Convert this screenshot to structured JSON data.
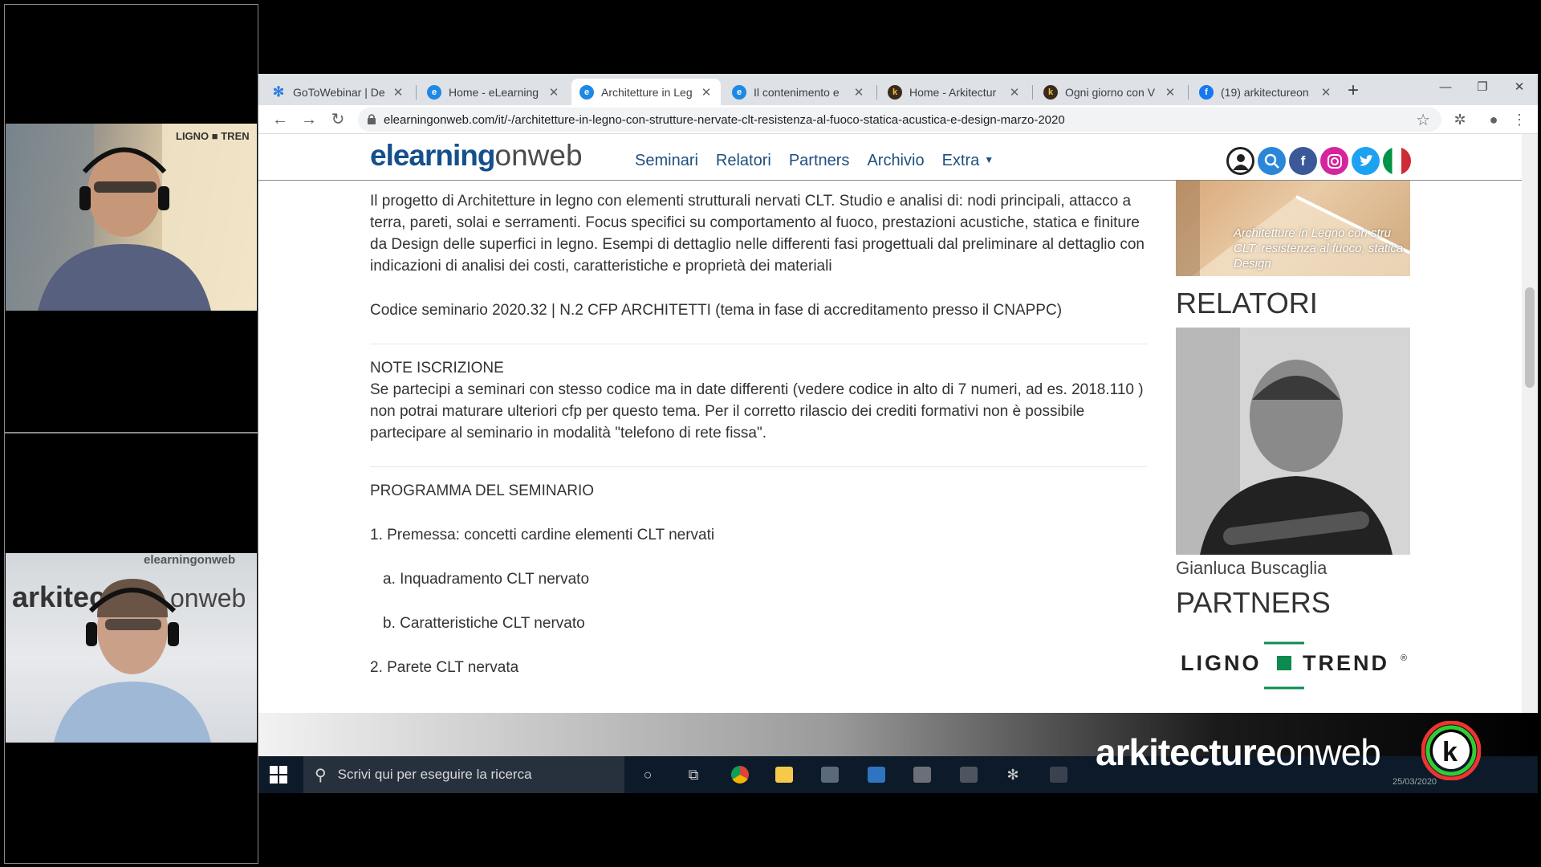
{
  "webinar": {
    "cam_top_name": "presenter-webcam",
    "cam_bottom_name": "host-webcam",
    "cam_top_banner": "LIGNO ■ TREN",
    "cam_bottom_banner_a": "elearningonweb",
    "cam_bottom_banner_b": "arkitec",
    "cam_bottom_banner_c": "onweb"
  },
  "browser": {
    "tabs": [
      {
        "title": "GoToWebinar | De",
        "icon": "snowflake-icon",
        "color": "#2d7de0"
      },
      {
        "title": "Home - eLearning",
        "icon": "e-icon",
        "color": "#1e88e5"
      },
      {
        "title": "Architetture in Leg",
        "icon": "e-icon",
        "color": "#1e88e5"
      },
      {
        "title": "Il contenimento e",
        "icon": "e-icon",
        "color": "#1e88e5"
      },
      {
        "title": "Home - Arkitectur",
        "icon": "k-icon",
        "color": "#3a2a1a"
      },
      {
        "title": "Ogni giorno con V",
        "icon": "k-icon",
        "color": "#3a2a1a"
      },
      {
        "title": "(19) arkitectureon",
        "icon": "facebook-icon",
        "color": "#1877f2"
      }
    ],
    "tab_close": "✕",
    "new_tab": "+",
    "url": "elearningonweb.com/it/-/architetture-in-legno-con-strutture-nervate-clt-resistenza-al-fuoco-statica-acustica-e-design-marzo-2020"
  },
  "site": {
    "logo_a": "elearning",
    "logo_b": "onweb",
    "nav": [
      "Seminari",
      "Relatori",
      "Partners",
      "Archivio",
      "Extra"
    ],
    "social": [
      {
        "name": "user-icon",
        "glyph": "◯",
        "color": "#222222"
      },
      {
        "name": "search-icon",
        "glyph": "⌕",
        "color": "#2a86d8"
      },
      {
        "name": "facebook-icon",
        "glyph": "f",
        "color": "#3b5998"
      },
      {
        "name": "instagram-icon",
        "glyph": "◎",
        "color": "#d6249f"
      },
      {
        "name": "twitter-icon",
        "glyph": "t",
        "color": "#1da1f2"
      },
      {
        "name": "italy-flag-icon",
        "glyph": "",
        "color": "#ffffff"
      }
    ]
  },
  "content": {
    "intro": "Il progetto di Architetture in legno con elementi strutturali nervati CLT. Studio e analisi di: nodi principali, attacco a terra, pareti, solai e serramenti. Focus specifici su comportamento al fuoco, prestazioni acustiche, statica e finiture da Design delle superfici in legno. Esempi di dettaglio nelle differenti fasi progettuali dal preliminare al dettaglio con indicazioni di analisi dei costi, caratteristiche e proprietà dei materiali",
    "codice": "Codice seminario 2020.32 | N.2 CFP ARCHITETTI (tema in fase di accreditamento presso il CNAPPC)",
    "note_title": "NOTE ISCRIZIONE",
    "note_body": "Se partecipi a seminari con stesso codice ma in date differenti (vedere codice in alto di 7 numeri, ad es. 2018.110 ) non potrai maturare ulteriori cfp per questo tema. Per il corretto rilascio dei crediti formativi non è possibile partecipare al seminario in modalità \"telefono di rete fissa\".",
    "program_title": "PROGRAMMA DEL SEMINARIO",
    "program": [
      {
        "text": "1. Premessa: concetti cardine elementi CLT nervati",
        "sub": false
      },
      {
        "text": "a. Inquadramento CLT nervato",
        "sub": true
      },
      {
        "text": "b. Caratteristiche CLT nervato",
        "sub": true
      },
      {
        "text": "2. Parete CLT nervata",
        "sub": false
      }
    ]
  },
  "sidebar": {
    "banner_caption": "Architetture in Legno con stru CLT: resistenza al fuoco, statica Design",
    "relatori_heading": "RELATORI",
    "speaker_name": "Gianluca Buscaglia",
    "partners_heading": "PARTNERS",
    "partner_logo_a": "LIGNO",
    "partner_logo_b": "TREND",
    "partner_reg": "®"
  },
  "taskbar": {
    "search_placeholder": "Scrivi qui per eseguire la ricerca",
    "clock_date": "25/03/2020"
  },
  "brand": {
    "logo_a": "arkitecture",
    "logo_b": "onweb"
  },
  "colors": {
    "link_blue": "#1f4f7f",
    "logo_blue": "#14508c",
    "ligno_green": "#0c8a4f"
  }
}
